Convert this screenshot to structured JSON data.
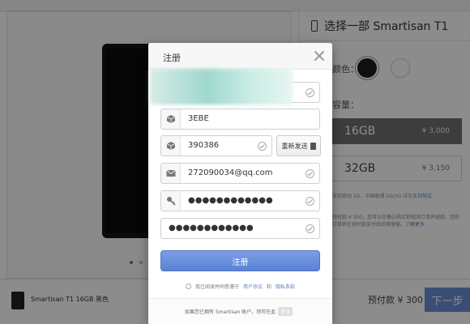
{
  "background": {
    "product_panel": {
      "title": "选择一部 Smartisan T1",
      "color_label": "颜色：",
      "capacity_label": "容量：",
      "options": [
        {
          "size": "16GB",
          "price": "¥ 3,000",
          "selected": true
        },
        {
          "size": "32GB",
          "price": "¥ 3,150",
          "selected": false
        }
      ],
      "note_1": "支持移动 2G，中国联通 2G/3G 详见",
      "note_1_link": "支持制式",
      "note_2": "预付款 ¥ 300，您可以在确认购买前取消订单并退款，您的订单将在预付款支付后获得保留。",
      "note_2_link": "了解更多"
    },
    "bottom_bar": {
      "product": "Smartisan T1 16GB 黑色",
      "prepay": "预付款 ¥ 300",
      "next_button": "下一步"
    },
    "colors": {
      "accent": "#6b8fd6",
      "selected_option": "#6f6f6f"
    }
  },
  "modal": {
    "title": "注册",
    "close_icon": "close-icon",
    "fields": {
      "username_value": "",
      "captcha_value": "3EBE",
      "sms_code_value": "390386",
      "resend_label": "重新发送",
      "email_value": "272090034@qq.com",
      "password_value": "●●●●●●●●●●●●",
      "confirm_password_value": "●●●●●●●●●●●●"
    },
    "submit_label": "注册",
    "agreement": {
      "prefix": "我已阅读并同意遵守",
      "user_agreement": "用户协议",
      "and": "和",
      "privacy_policy": "隐私条款"
    },
    "footer": {
      "text": "如果您已拥有 Smartisan 账户，则可在此",
      "login_label": "登录"
    },
    "colors": {
      "submit": "#5b82d4",
      "link": "#5a7fc7"
    }
  }
}
